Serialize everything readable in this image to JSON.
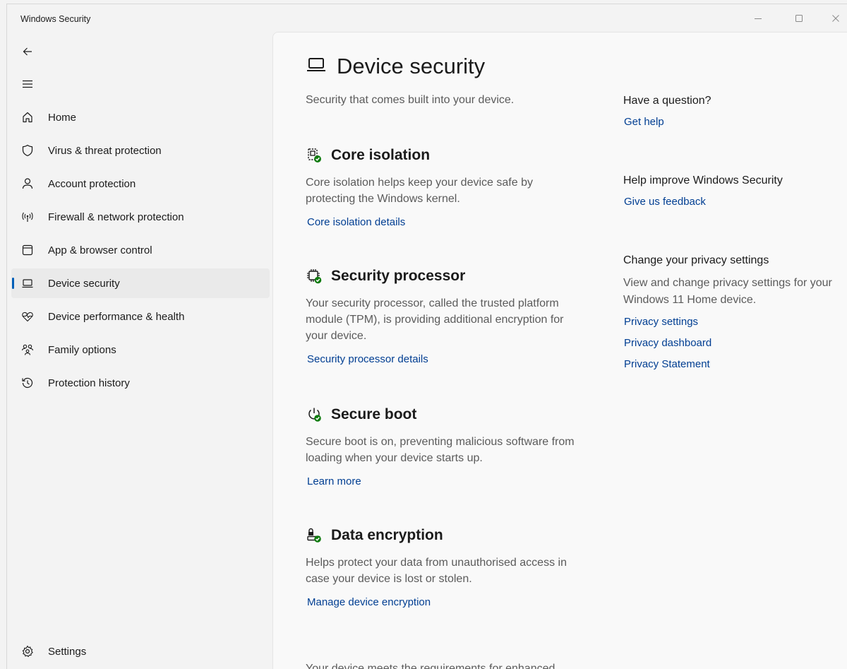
{
  "window": {
    "title": "Windows Security"
  },
  "nav": {
    "items": [
      {
        "label": "Home"
      },
      {
        "label": "Virus & threat protection"
      },
      {
        "label": "Account protection"
      },
      {
        "label": "Firewall & network protection"
      },
      {
        "label": "App & browser control"
      },
      {
        "label": "Device security"
      },
      {
        "label": "Device performance & health"
      },
      {
        "label": "Family options"
      },
      {
        "label": "Protection history"
      }
    ],
    "settings_label": "Settings",
    "active_index": 5
  },
  "page": {
    "title": "Device security",
    "subtitle": "Security that comes built into your device.",
    "sections": [
      {
        "title": "Core isolation",
        "description": "Core isolation helps keep your device safe by protecting the Windows kernel.",
        "link": "Core isolation details"
      },
      {
        "title": "Security processor",
        "description": "Your security processor, called the trusted platform module (TPM), is providing additional encryption for your device.",
        "link": "Security processor details"
      },
      {
        "title": "Secure boot",
        "description": "Secure boot is on, preventing malicious software from loading when your device starts up.",
        "link": "Learn more"
      },
      {
        "title": "Data encryption",
        "description": "Helps protect your data from unauthorised access in case your device is lost or stolen.",
        "link": "Manage device encryption"
      }
    ],
    "footer_text": "Your device meets the requirements for enhanced hardware security."
  },
  "side": {
    "question_heading": "Have a question?",
    "get_help": "Get help",
    "improve_heading": "Help improve Windows Security",
    "feedback": "Give us feedback",
    "privacy_heading": "Change your privacy settings",
    "privacy_desc": "View and change privacy settings for your Windows 11 Home device.",
    "privacy_links": [
      "Privacy settings",
      "Privacy dashboard",
      "Privacy Statement"
    ]
  },
  "colors": {
    "accent": "#005fb8",
    "link": "#003e92",
    "status_ok": "#0f7b0f"
  }
}
